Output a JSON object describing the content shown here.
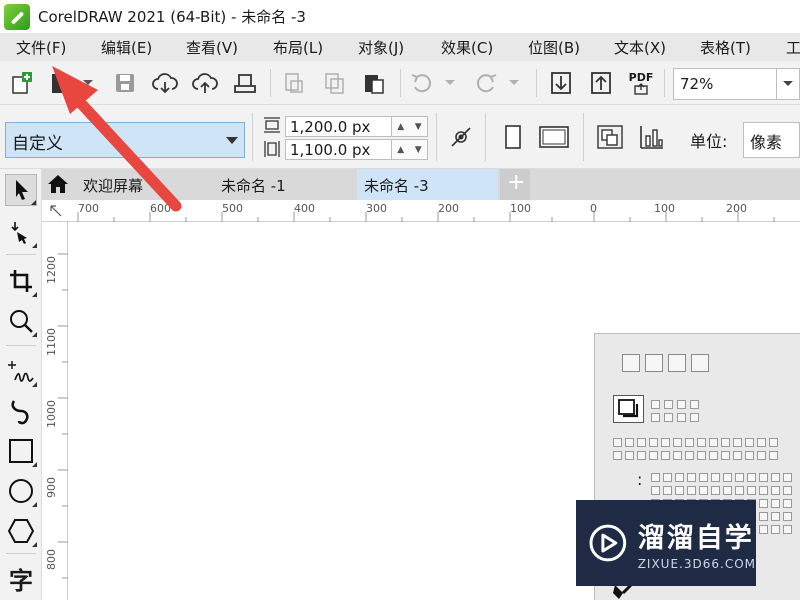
{
  "window": {
    "title": "CorelDRAW 2021 (64-Bit) - 未命名 -3"
  },
  "menu": [
    "文件(F)",
    "编辑(E)",
    "查看(V)",
    "布局(L)",
    "对象(J)",
    "效果(C)",
    "位图(B)",
    "文本(X)",
    "表格(T)",
    "工"
  ],
  "toolbar": {
    "pdf_label": "PDF",
    "zoom_value": "72%"
  },
  "property_bar": {
    "preset": "自定义",
    "width": "1,200.0 px",
    "height": "1,100.0 px",
    "units_label": "单位:",
    "units_value": "像素"
  },
  "toolbox": {
    "text_tool_glyph": "字"
  },
  "tabs": [
    {
      "label": "欢迎屏幕",
      "active": false
    },
    {
      "label": "未命名 -1",
      "active": false
    },
    {
      "label": "未命名 -3",
      "active": true
    }
  ],
  "rulers": {
    "h_ticks": [
      "700",
      "600",
      "500",
      "400",
      "300",
      "200",
      "100",
      "0",
      "100",
      "200"
    ],
    "v_ticks": [
      "1200",
      "1100",
      "1000",
      "900",
      "800"
    ]
  },
  "watermark": {
    "title": "溜溜自学",
    "subtitle": "ZIXUE.3D66.COM"
  },
  "colors": {
    "accent_blue": "#cfe4f7",
    "annotation_red": "#e8473f",
    "watermark_bg": "#1f2a44"
  }
}
